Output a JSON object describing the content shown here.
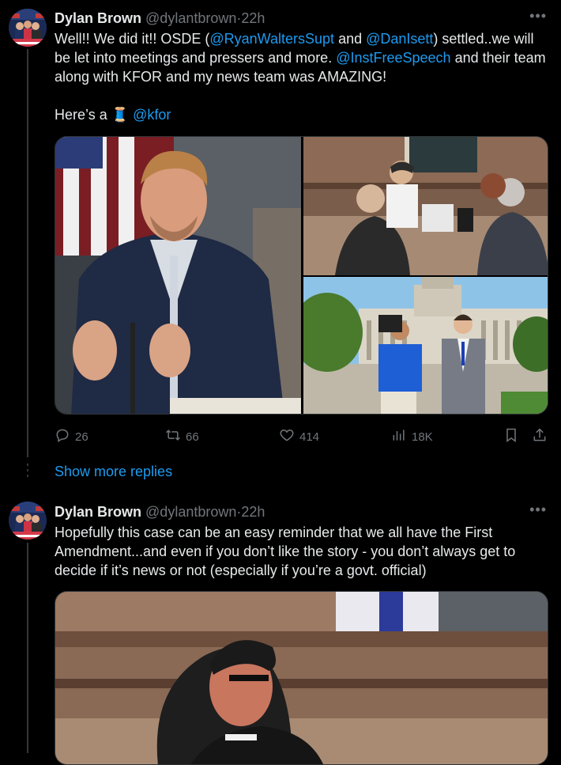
{
  "tweets": [
    {
      "author_name": "Dylan Brown",
      "handle": "@dylantbrown",
      "separator": "·",
      "time": "22h",
      "more_icon": "ellipsis-icon",
      "text_parts": {
        "p1": "Well!! We did it!! OSDE (",
        "m1": "@RyanWaltersSupt",
        "p2": " and ",
        "m2": "@DanIsett",
        "p3": ") settled..we will be let into meetings and pressers and more. ",
        "m3": "@InstFreeSpeech",
        "p4": " and their team along with KFOR and my news team was AMAZING!",
        "p5": "Here’s a ",
        "emoji": "🧵",
        "m4": "@kfor"
      },
      "actions": {
        "replies": "26",
        "reposts": "66",
        "likes": "414",
        "views": "18K"
      }
    },
    {
      "author_name": "Dylan Brown",
      "handle": "@dylantbrown",
      "separator": "·",
      "time": "22h",
      "more_icon": "ellipsis-icon",
      "text": "Hopefully this case can be an easy reminder that we all have the First Amendment...and even if you don’t like the story - you don’t always get to decide if it’s news or not (especially if you’re a govt. official)"
    }
  ],
  "show_more_replies": "Show more replies",
  "colors": {
    "background": "#000000",
    "text": "#e7e9ea",
    "muted": "#71767b",
    "link": "#1d9bf0"
  }
}
